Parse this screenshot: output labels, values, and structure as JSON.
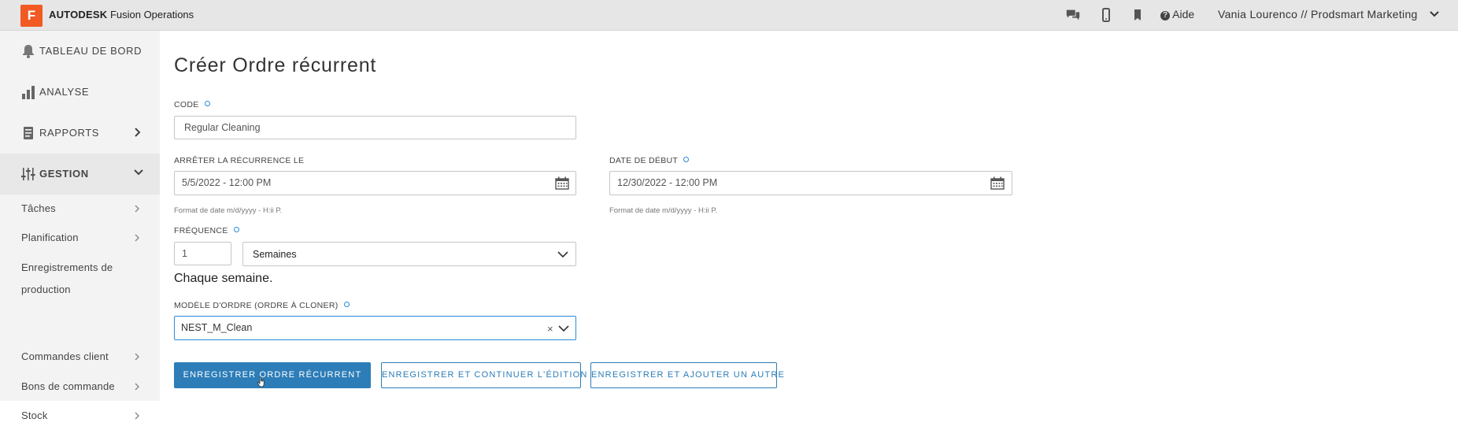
{
  "header": {
    "logo_letter": "F",
    "brand_bold": "AUTODESK",
    "brand_rest": "Fusion Operations",
    "help_label": "Aide",
    "user_label": "Vania Lourenco // Prodsmart Marketing"
  },
  "sidebar": {
    "items": [
      {
        "label": "TABLEAU DE BORD",
        "icon": "bell-icon"
      },
      {
        "label": "ANALYSE",
        "icon": "bar-chart-icon"
      },
      {
        "label": "RAPPORTS",
        "icon": "report-icon"
      },
      {
        "label": "GESTION",
        "icon": "sliders-icon"
      }
    ],
    "sub_items": [
      {
        "label": "Tâches"
      },
      {
        "label": "Planification"
      },
      {
        "label": "Enregistrements de"
      },
      {
        "label": "production"
      },
      {
        "label": "Commandes client"
      },
      {
        "label": "Bons de commande"
      },
      {
        "label": "Stock"
      }
    ]
  },
  "form": {
    "title": "Créer Ordre récurrent",
    "code_label": "CODE",
    "code_value": "Regular Cleaning",
    "stop_label": "ARRÊTER LA RÉCURRENCE LE",
    "stop_value": "5/5/2022 - 12:00 PM",
    "stop_hint": "Format de date m/d/yyyy - H:ii P.",
    "start_label": "DATE DE DÉBUT",
    "start_value": "12/30/2022 - 12:00 PM",
    "start_hint": "Format de date m/d/yyyy - H:ii P.",
    "freq_label": "FRÉQUENCE",
    "freq_number": "1",
    "freq_unit": "Semaines",
    "freq_description": "Chaque semaine.",
    "template_label": "MODÈLE D'ORDRE (ORDRE À CLONER)",
    "template_value": "NEST_M_Clean",
    "clear_symbol": "×"
  },
  "buttons": {
    "save": "ENREGISTRER ORDRE RÉCURRENT",
    "save_continue": "ENREGISTRER ET CONTINUER L'ÉDITION",
    "save_add": "ENREGISTRER ET AJOUTER UN AUTRE"
  },
  "colors": {
    "accent": "#2c7db8",
    "brand": "#f15a22",
    "topbar": "#e6e6e6",
    "sidebar": "#f3f3f3"
  }
}
